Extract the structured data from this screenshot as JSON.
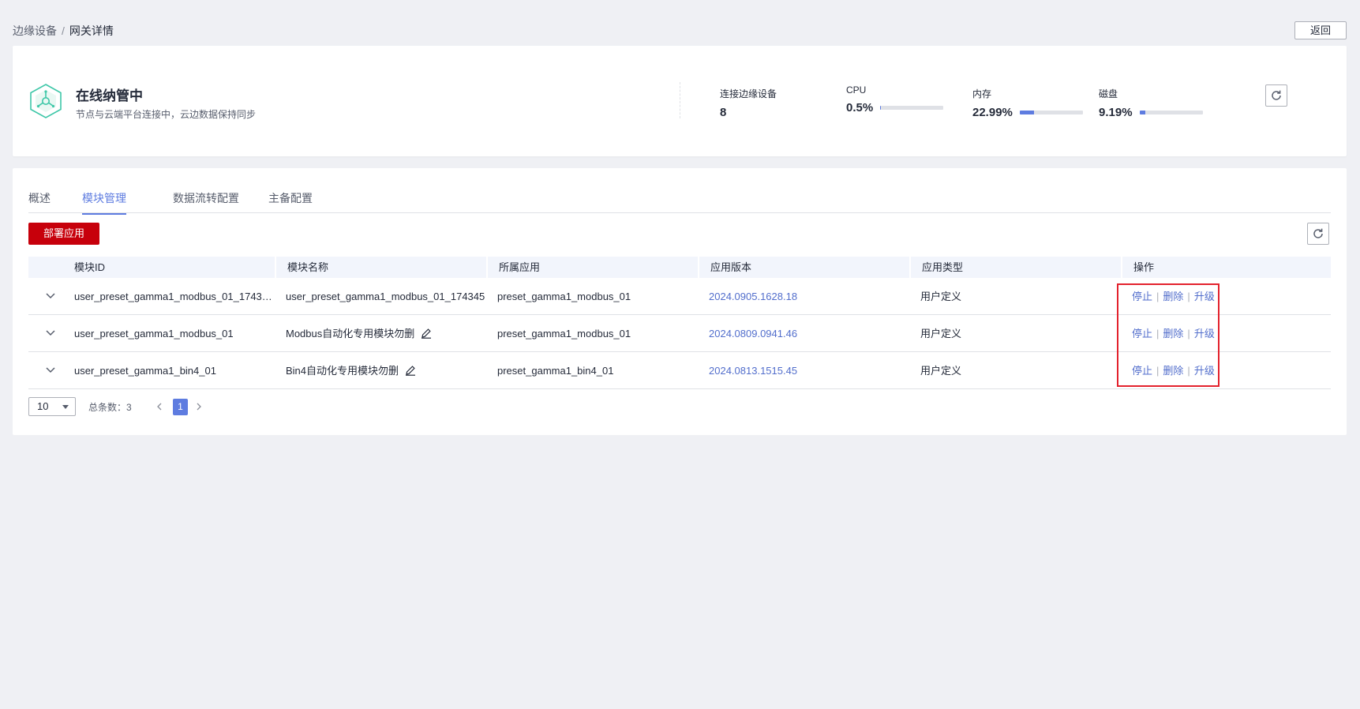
{
  "breadcrumb": {
    "parent": "边缘设备",
    "separator": "/",
    "current": "网关详情"
  },
  "header": {
    "back_label": "返回"
  },
  "status": {
    "title": "在线纳管中",
    "description": "节点与云端平台连接中，云边数据保持同步",
    "icon": "hexagon-node-icon",
    "icon_color": "#3ec7a8",
    "metrics": {
      "devices": {
        "label": "连接边缘设备",
        "value": "8"
      },
      "cpu": {
        "label": "CPU",
        "value": "0.5%",
        "fraction": 0.005
      },
      "memory": {
        "label": "内存",
        "value": "22.99%",
        "fraction": 0.2299
      },
      "disk": {
        "label": "磁盘",
        "value": "9.19%",
        "fraction": 0.0919
      }
    }
  },
  "tabs": [
    {
      "label": "概述",
      "active": false
    },
    {
      "label": "模块管理",
      "active": true
    },
    {
      "label": "数据流转配置",
      "active": false
    },
    {
      "label": "主备配置",
      "active": false
    }
  ],
  "toolbar": {
    "deploy_label": "部署应用"
  },
  "table": {
    "columns": [
      "模块ID",
      "模块名称",
      "所属应用",
      "应用版本",
      "应用类型",
      "操作"
    ],
    "rows": [
      {
        "id": "user_preset_gamma1_modbus_01_174345...",
        "name": "user_preset_gamma1_modbus_01_174345",
        "app": "preset_gamma1_modbus_01",
        "version": "2024.0905.1628.18",
        "type": "用户定义"
      },
      {
        "id": "user_preset_gamma1_modbus_01",
        "name": "Modbus自动化专用模块勿删",
        "app": "preset_gamma1_modbus_01",
        "version": "2024.0809.0941.46",
        "type": "用户定义"
      },
      {
        "id": "user_preset_gamma1_bin4_01",
        "name": "Bin4自动化专用模块勿删",
        "app": "preset_gamma1_bin4_01",
        "version": "2024.0813.1515.45",
        "type": "用户定义"
      }
    ],
    "actions": {
      "stop": "停止",
      "delete": "删除",
      "upgrade": "升级",
      "separator": "|"
    }
  },
  "pagination": {
    "page_size": "10",
    "total_label": "总条数：3",
    "current_page": "1"
  },
  "colors": {
    "accent": "#5e7ce0",
    "primary_button": "#c7000b",
    "highlight": "#e3222d",
    "link": "#526ecc"
  }
}
